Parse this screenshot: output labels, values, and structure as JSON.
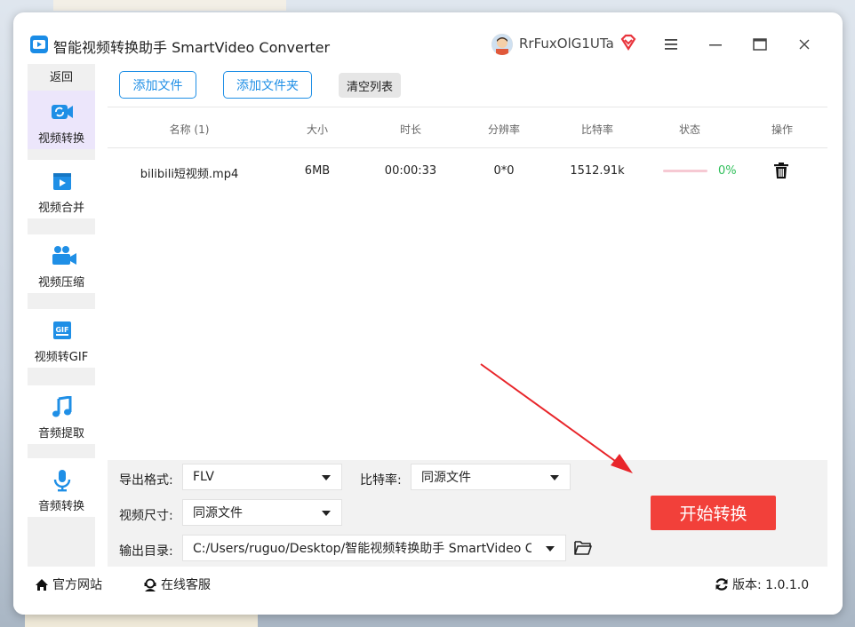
{
  "window": {
    "title": "智能视频转换助手 SmartVideo Converter",
    "username": "RrFuxOlG1UTa",
    "menu_icon": "hamburger-menu-icon",
    "minimize_icon": "minimize-icon",
    "maximize_icon": "maximize-icon",
    "close_icon": "close-icon"
  },
  "sidebar": {
    "back_label": "返回",
    "items": [
      {
        "label": "视频转换",
        "icon": "video-convert-icon",
        "active": true
      },
      {
        "label": "视频合并",
        "icon": "video-merge-icon",
        "active": false
      },
      {
        "label": "视频压缩",
        "icon": "video-compress-icon",
        "active": false
      },
      {
        "label": "视频转GIF",
        "icon": "gif-icon",
        "active": false
      },
      {
        "label": "音频提取",
        "icon": "music-note-icon",
        "active": false
      },
      {
        "label": "音频转换",
        "icon": "microphone-icon",
        "active": false
      }
    ]
  },
  "toolbar": {
    "add_file": "添加文件",
    "add_folder": "添加文件夹",
    "clear_list": "清空列表"
  },
  "table": {
    "headers": {
      "name": "名称 (1)",
      "size": "大小",
      "duration": "时长",
      "resolution": "分辨率",
      "bitrate": "比特率",
      "status": "状态",
      "action": "操作"
    },
    "rows": [
      {
        "name": "bilibili短视频.mp4",
        "size": "6MB",
        "duration": "00:00:33",
        "resolution": "0*0",
        "bitrate": "1512.91k",
        "progress": 0,
        "progress_text": "0%"
      }
    ]
  },
  "settings": {
    "format_label": "导出格式:",
    "format_value": "FLV",
    "bitrate_label": "比特率:",
    "bitrate_value": "同源文件",
    "size_label": "视频尺寸:",
    "size_value": "同源文件",
    "output_label": "输出目录:",
    "output_value": "C:/Users/ruguo/Desktop/智能视频转换助手 SmartVideo Co"
  },
  "start_button": "开始转换",
  "footer": {
    "website": "官方网站",
    "support": "在线客服",
    "version": "版本: 1.0.1.0"
  },
  "colors": {
    "accent": "#1f8fe6",
    "start": "#f2403a",
    "progress_ok": "#2fbf5a",
    "active_nav": "#ece6fb"
  }
}
